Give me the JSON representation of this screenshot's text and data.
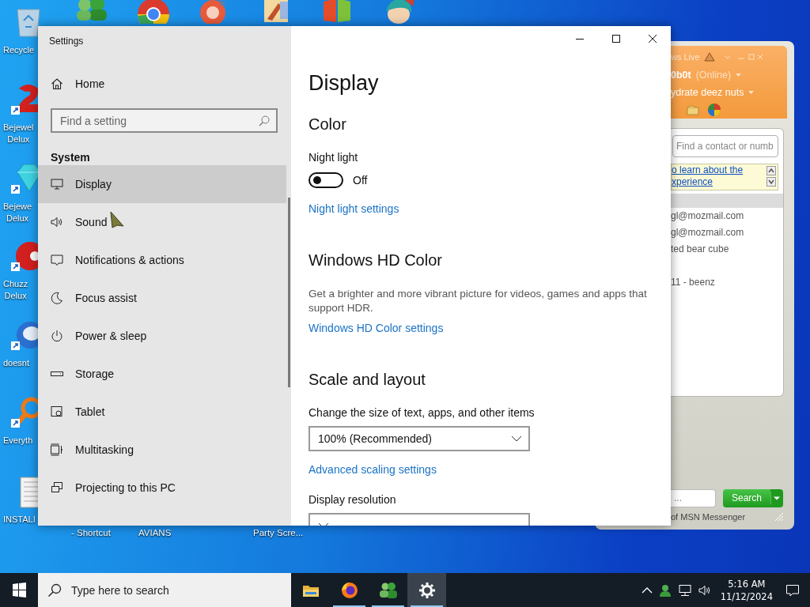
{
  "desktop": {
    "icons": [
      {
        "label": "Recycle",
        "shortcut": false
      },
      {
        "label": "Bejewel\nDelux",
        "shortcut": true
      },
      {
        "label": "Bejewe\nDelux",
        "shortcut": true
      },
      {
        "label": "Chuzz\nDelux",
        "shortcut": true
      },
      {
        "label": "doesnt",
        "shortcut": true
      },
      {
        "label": "Everyth",
        "shortcut": true
      },
      {
        "label": "INSTALI",
        "shortcut": false
      }
    ],
    "bottom_labels": [
      "- Shortcut",
      "AVIANS",
      "Party Scre..."
    ]
  },
  "settings": {
    "window": {
      "title": "Settings"
    },
    "home": "Home",
    "search": {
      "placeholder": "Find a setting"
    },
    "section": "System",
    "nav": [
      {
        "label": "Display",
        "selected": true
      },
      {
        "label": "Sound",
        "selected": false
      },
      {
        "label": "Notifications & actions",
        "selected": false
      },
      {
        "label": "Focus assist",
        "selected": false
      },
      {
        "label": "Power & sleep",
        "selected": false
      },
      {
        "label": "Storage",
        "selected": false
      },
      {
        "label": "Tablet",
        "selected": false
      },
      {
        "label": "Multitasking",
        "selected": false
      },
      {
        "label": "Projecting to this PC",
        "selected": false
      }
    ],
    "content": [
      {
        "kind": "title",
        "text": "Display"
      },
      {
        "kind": "heading",
        "text": "Color"
      },
      {
        "kind": "label",
        "text": "Night light"
      },
      {
        "kind": "toggle",
        "on": false,
        "text": "Off"
      },
      {
        "kind": "link",
        "text": "Night light settings"
      },
      {
        "kind": "heading",
        "text": "Windows HD Color"
      },
      {
        "kind": "paragraph",
        "text": "Get a brighter and more vibrant picture for videos, games and apps that support HDR."
      },
      {
        "kind": "link",
        "text": "Windows HD Color settings"
      },
      {
        "kind": "heading",
        "text": "Scale and layout"
      },
      {
        "kind": "label",
        "text": "Change the size of text, apps, and other items"
      },
      {
        "kind": "dropdown",
        "value": "100% (Recommended)"
      },
      {
        "kind": "link",
        "text": "Advanced scaling settings"
      },
      {
        "kind": "label",
        "text": "Display resolution"
      },
      {
        "kind": "dropdown"
      }
    ]
  },
  "messenger": {
    "title": "ws Live",
    "user": "0b0t",
    "status": "(Online)",
    "message": "ydrate deez nuts",
    "search": {
      "placeholder": "Find a contact or numb"
    },
    "banner": [
      "o learn about the",
      "xperience"
    ],
    "contacts": [
      "gl@mozmail.com",
      "gl@mozmail.com",
      "ted bear cube",
      "11 - beenz"
    ],
    "input": {
      "placeholder": "..."
    },
    "search_button": "Search",
    "footer": "of MSN Messenger"
  },
  "taskbar": {
    "search": {
      "placeholder": "Type here to search"
    },
    "apps": [
      {
        "running": false,
        "selected": false
      },
      {
        "running": true,
        "selected": false
      },
      {
        "running": true,
        "selected": false
      },
      {
        "running": true,
        "selected": true
      }
    ],
    "time": "5:16 AM",
    "date": "11/12/2024"
  }
}
